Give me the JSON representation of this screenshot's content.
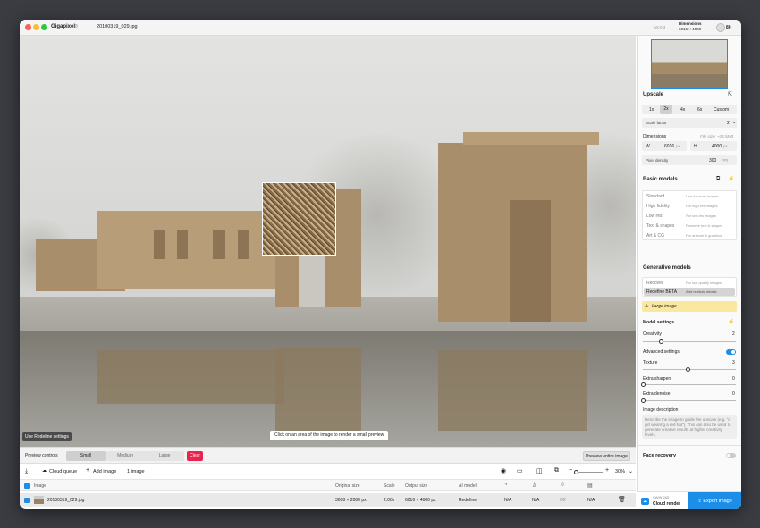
{
  "titlebar": {
    "app": "Gigapixel",
    "app_badge": "8",
    "file": "20100319_029.jpg",
    "version": "v8.0.3",
    "dim_label": "Dimensions",
    "dim_value": "6016 × 4000",
    "credits": "80"
  },
  "canvas": {
    "overlay_btn": "Use Redefine settings",
    "hint": "Click on an area of the image to render a small preview"
  },
  "preview": {
    "label": "Preview controls",
    "sizes": [
      "Small",
      "Medium",
      "Large"
    ],
    "selected": "Small",
    "clear": "Clear",
    "entire": "Preview entire image"
  },
  "queue": {
    "cloud": "Cloud queue",
    "add": "Add image",
    "count": "1 image",
    "zoom": "30%"
  },
  "table": {
    "headers": [
      "Image",
      "Original size",
      "Scale",
      "Output size",
      "AI model"
    ],
    "row": {
      "name": "20100319_029.jpg",
      "orig": "3008 × 2000 px",
      "scale": "2.00x",
      "output": "6016 × 4000 px",
      "model": "Redefine",
      "c1": "N/A",
      "c2": "N/A",
      "c3": "Off",
      "c4": "N/A"
    }
  },
  "side": {
    "upscale": "Upscale",
    "scales": [
      "1x",
      "2x",
      "4x",
      "6x",
      "Custom"
    ],
    "selected_scale": "2x",
    "scale_factor": "Scale factor",
    "scale_factor_val": "2",
    "dimensions": "Dimensions",
    "file_size": "File size: ~23.5MB",
    "w_label": "W",
    "w_val": "6016",
    "w_unit": "px",
    "h_label": "H",
    "h_val": "4000",
    "pixel_density": "Pixel density",
    "pd_val": "300",
    "pd_unit": "PPI",
    "basic": "Basic models",
    "models": [
      {
        "n": "Standard",
        "d": "Use for most images"
      },
      {
        "n": "High fidelity",
        "d": "For high-res images"
      },
      {
        "n": "Low res",
        "d": "For low-res images"
      },
      {
        "n": "Text & shapes",
        "d": "Preserve text & shapes"
      },
      {
        "n": "Art & CG",
        "d": "For artwork & graphics"
      }
    ],
    "generative": "Generative models",
    "gen": [
      {
        "n": "Recover",
        "d": "For low-quality images"
      },
      {
        "n": "Redefine BETA",
        "d": "Add realistic details"
      }
    ],
    "warning": "Large image",
    "model_settings": "Model settings",
    "creativity": "Creativity",
    "creativity_val": "2",
    "advanced": "Advanced settings",
    "texture": "Texture",
    "texture_val": "3",
    "sharpen": "Extra sharpen",
    "sharpen_val": "0",
    "denoise": "Extra denoise",
    "denoise_val": "0",
    "image_desc": "Image description",
    "desc_placeholder": "Describe the image to guide the upscale (e.g. \"a girl wearing a red hat\"). This can also be used to generate creative results at higher creativity levels.",
    "face": "Face recovery",
    "cloud_count": "SWIN 265",
    "cloud_render": "Cloud render",
    "export": "Export image"
  },
  "colors": {
    "accent": "#1c8ee8",
    "danger": "#e8234d",
    "warning": "#fbe8a0"
  }
}
